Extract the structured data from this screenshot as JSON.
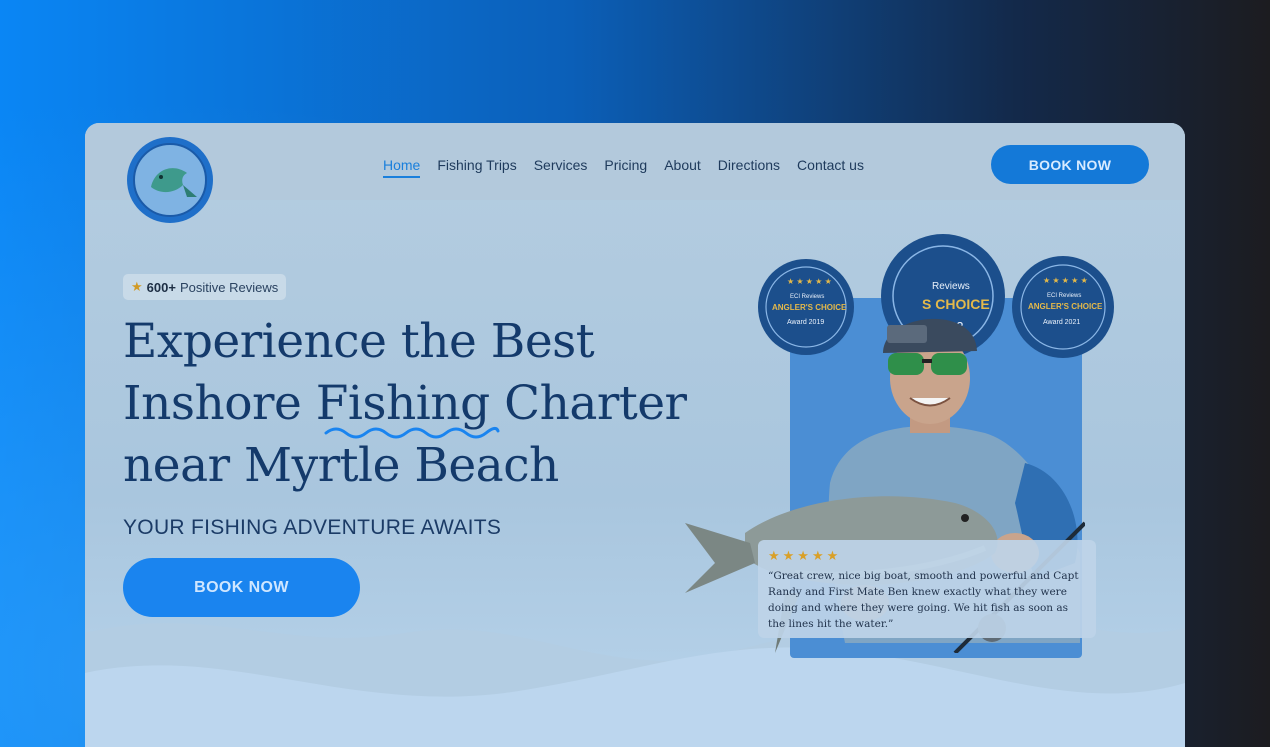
{
  "nav": {
    "items": [
      {
        "label": "Home",
        "active": true
      },
      {
        "label": "Fishing Trips",
        "active": false
      },
      {
        "label": "Services",
        "active": false
      },
      {
        "label": "Pricing",
        "active": false
      },
      {
        "label": "About",
        "active": false
      },
      {
        "label": "Directions",
        "active": false
      },
      {
        "label": "Contact us",
        "active": false
      }
    ],
    "book_label": "BOOK NOW"
  },
  "hero": {
    "reviews_count": "600+",
    "reviews_label": "Positive Reviews",
    "headline_line1": "Experience the Best",
    "headline_line2_a": "Inshore ",
    "headline_line2_b": "Fishing",
    "headline_line2_c": " Charter",
    "headline_line3": "near Myrtle Beach",
    "tagline": "YOUR FISHING ADVENTURE AWAITS",
    "book_label": "BOOK NOW"
  },
  "badges": [
    {
      "source": "ECI Reviews",
      "title": "ANGLER'S CHOICE",
      "year": "Award 2019"
    },
    {
      "source": "Reviews",
      "title": "S CHOICE",
      "year": "l 2022"
    },
    {
      "source": "ECI Reviews",
      "title": "ANGLER'S CHOICE",
      "year": "Award 2021"
    }
  ],
  "testimonial": {
    "rating": 5,
    "stars": "★★★★★",
    "text": "“Great crew, nice big boat, smooth and powerful and Capt Randy and First Mate Ben knew exactly what they were doing and where they were going. We hit fish as soon as the lines hit the water.”"
  },
  "icons": [
    "logo-icon",
    "star-icon",
    "wave-underline-icon",
    "award-badge-icon"
  ],
  "colors": {
    "accent": "#1a84ef",
    "headline": "#143a6b",
    "badge": "#1c4f8c",
    "star": "#d9a028"
  }
}
